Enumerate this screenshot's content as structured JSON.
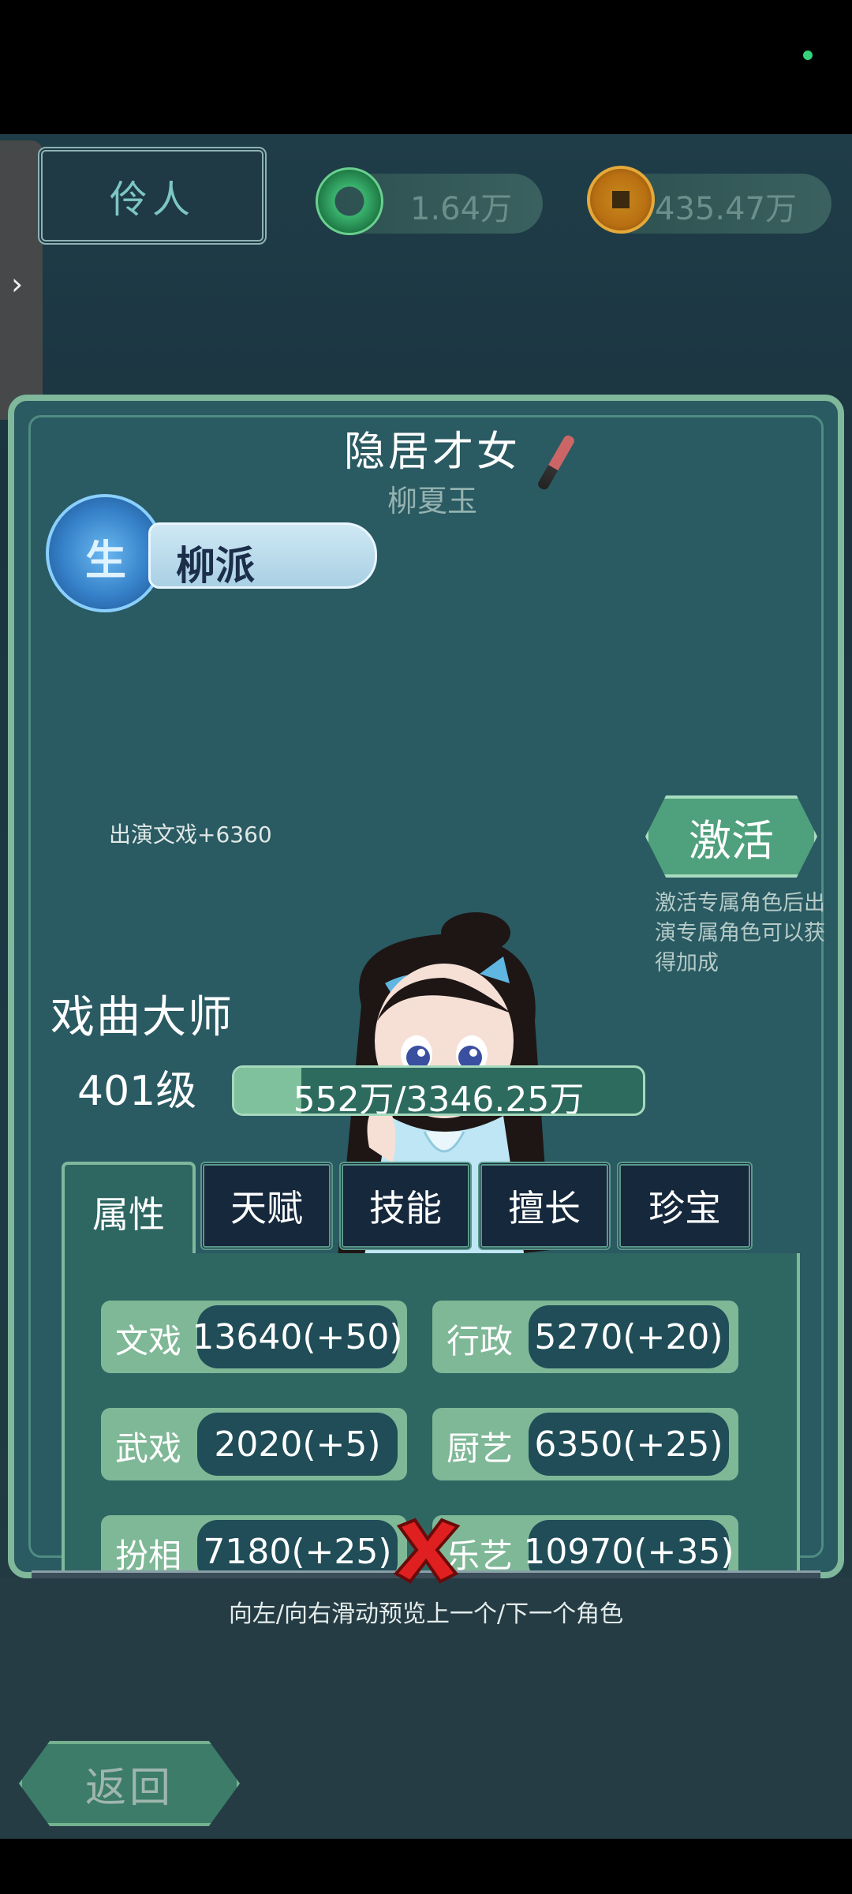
{
  "header": {
    "title": "伶人",
    "currencies": [
      {
        "name": "jade",
        "value": "1.64万"
      },
      {
        "name": "coin",
        "value": "435.47万"
      }
    ]
  },
  "character": {
    "title": "隐居才女",
    "name": "柳夏玉",
    "faction": {
      "badge": "生",
      "name": "柳派",
      "bonus": "出演文戏+6360"
    },
    "rank": "戏曲大师",
    "level": "401级",
    "exp": {
      "text": "552万/3346.25万",
      "fraction": 0.165
    }
  },
  "activate": {
    "label": "激活",
    "description": "激活专属角色后出演专属角色可以获得加成"
  },
  "tabs": [
    "属性",
    "天赋",
    "技能",
    "擅长",
    "珍宝"
  ],
  "stats": [
    {
      "label": "文戏",
      "value": "13640(+50)"
    },
    {
      "label": "行政",
      "value": "5270(+20)"
    },
    {
      "label": "武戏",
      "value": "2020(+5)"
    },
    {
      "label": "厨艺",
      "value": "6350(+25)"
    },
    {
      "label": "扮相",
      "value": "7180(+25)"
    },
    {
      "label": "乐艺",
      "value": "10970(+35)"
    }
  ],
  "hint": "向左/向右滑动预览上一个/下一个角色",
  "back_label": "返回",
  "colors": {
    "panel": "#2a5a62",
    "accent": "#7fb89b",
    "value_bg": "#204d57",
    "close": "#e02020"
  }
}
